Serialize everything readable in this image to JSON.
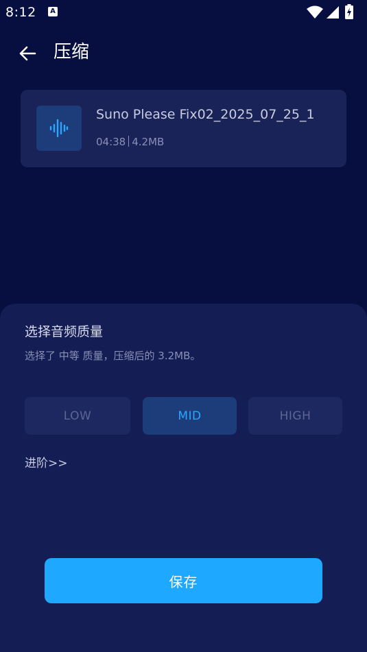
{
  "status_bar": {
    "time": "8:12",
    "notification_icon": "a-notification-icon",
    "icons": [
      "wifi-icon",
      "cellular-signal-icon",
      "battery-charging-icon"
    ]
  },
  "header": {
    "back_icon": "arrow-left-icon",
    "title": "压缩"
  },
  "file": {
    "icon": "audio-waveform-icon",
    "name": "Suno Please Fix02_2025_07_25_1",
    "duration": "04:38",
    "size": "4.2MB"
  },
  "quality_sheet": {
    "title": "选择音频质量",
    "subtitle": "选择了 中等 质量，压缩后的 3.2MB。",
    "options": [
      {
        "label": "LOW",
        "selected": false
      },
      {
        "label": "MID",
        "selected": true
      },
      {
        "label": "HIGH",
        "selected": false
      }
    ],
    "advanced_label": "进阶>>",
    "save_label": "保存"
  },
  "colors": {
    "background": "#070f40",
    "card": "#1a2358",
    "sheet": "#141e55",
    "accent": "#1fa8ff",
    "selected_option_bg": "#1d3c7a",
    "selected_option_text": "#2aa6ff"
  }
}
